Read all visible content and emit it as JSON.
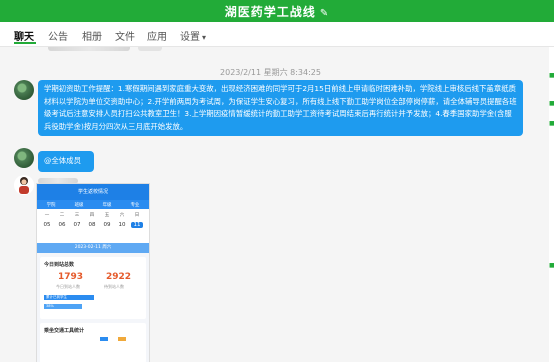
{
  "window": {
    "title": "湖医药学工战线",
    "edit_icon": "✎"
  },
  "tabs": [
    {
      "label": "聊天",
      "active": true
    },
    {
      "label": "公告"
    },
    {
      "label": "相册"
    },
    {
      "label": "文件"
    },
    {
      "label": "应用"
    },
    {
      "label": "设置",
      "dropdown": true
    }
  ],
  "chat": {
    "timestamp": "2023/2/11 星期六 8:34:25",
    "messages": [
      {
        "type": "text",
        "text": "学期初资助工作提醒：1.寒假期间遇到家庭重大变故，出现经济困难的同学可于2月15日前线上申请临时困难补助，学院线上审核后线下盖章纸质材料以学院为单位交资助中心；2.开学前两周为考试周，为保证学生安心复习，所有线上线下勤工助学岗位全部停岗停薪，请全体辅导员提醒各班级考试后注意安排人员打扫公共教室卫生！3.上学期因疫情暂缓统计的勤工助学工资待考试周结束后再行统计并予发放；4.春季国家助学金(含服兵役助学金)按月分四次从三月底开始发放。"
      },
      {
        "type": "text",
        "text": "@全体成员"
      },
      {
        "type": "image"
      }
    ]
  },
  "shared_image": {
    "header": "学生返校情况",
    "tabs": [
      "学院",
      "班级",
      "年级",
      "专业"
    ],
    "weekdays": [
      "一",
      "二",
      "三",
      "四",
      "五",
      "六",
      "日"
    ],
    "dates": [
      "05",
      "06",
      "07",
      "08",
      "09",
      "10",
      "11"
    ],
    "selected_date": "11",
    "date_bar": "2023-02-11 周六",
    "card_title": "今日到站总数",
    "stat_left": {
      "value": "1793",
      "label": "今日到站人数"
    },
    "stat_right": {
      "value": "2922",
      "label": "待到站人数"
    },
    "progress_1": "累计已到学生",
    "progress_2": "38%",
    "card2_title": "乘坐交通工具统计"
  },
  "colors": {
    "titlebar": "#22ab38",
    "bubble": "#1e9bef",
    "tab_underline": "#22ab38"
  }
}
